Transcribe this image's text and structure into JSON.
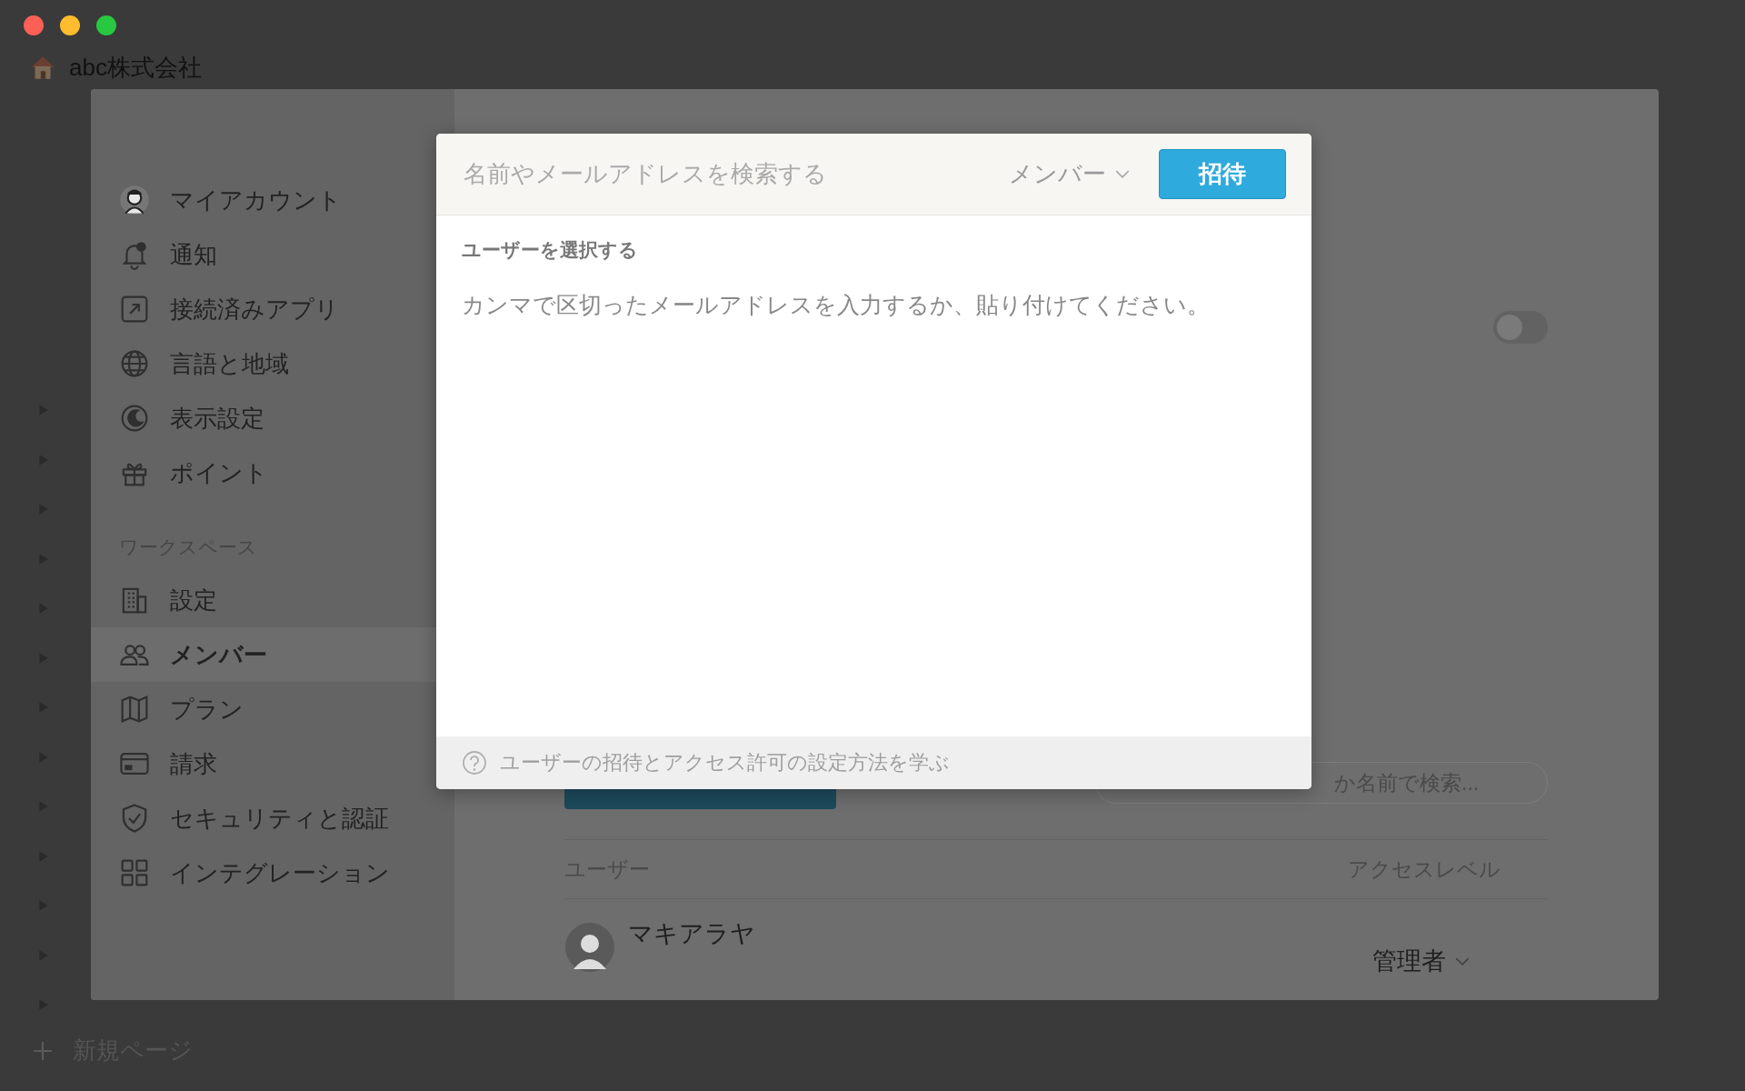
{
  "app_sidebar": {
    "workspace_name": "abc株式会社",
    "new_page": "新規ページ"
  },
  "settings_nav": {
    "sections": [
      {
        "items": [
          {
            "kind": "avatar",
            "label": "マイアカウント",
            "selected": false
          },
          {
            "kind": "bell",
            "label": "通知",
            "selected": false
          },
          {
            "kind": "arrow-box",
            "label": "接続済みアプリ",
            "selected": false
          },
          {
            "kind": "globe",
            "label": "言語と地域",
            "selected": false
          },
          {
            "kind": "moon",
            "label": "表示設定",
            "selected": false
          },
          {
            "kind": "gift",
            "label": "ポイント",
            "selected": false
          }
        ]
      },
      {
        "heading": "ワークスペース",
        "items": [
          {
            "kind": "building",
            "label": "設定",
            "selected": false
          },
          {
            "kind": "people",
            "label": "メンバー",
            "selected": true
          },
          {
            "kind": "map",
            "label": "プラン",
            "selected": false
          },
          {
            "kind": "card",
            "label": "請求",
            "selected": false
          },
          {
            "kind": "shield",
            "label": "セキュリティと認証",
            "selected": false
          },
          {
            "kind": "grid",
            "label": "インテグレーション",
            "selected": false
          }
        ]
      }
    ]
  },
  "members_page": {
    "toggle": {
      "on": false
    },
    "search": {
      "placeholder": "か名前で検索..."
    },
    "table": {
      "columns": [
        "ユーザー",
        "アクセスレベル"
      ],
      "rows": [
        {
          "name": "マキアラヤ",
          "access": "管理者"
        }
      ]
    }
  },
  "invite_dialog": {
    "search": {
      "placeholder": "名前やメールアドレスを検索する"
    },
    "role": "メンバー",
    "invite_button": "招待",
    "section_label": "ユーザーを選択する",
    "hint": "カンマで区切ったメールアドレスを入力するか、貼り付けてください。",
    "footer_link": "ユーザーの招待とアクセス許可の設定方法を学ぶ"
  }
}
